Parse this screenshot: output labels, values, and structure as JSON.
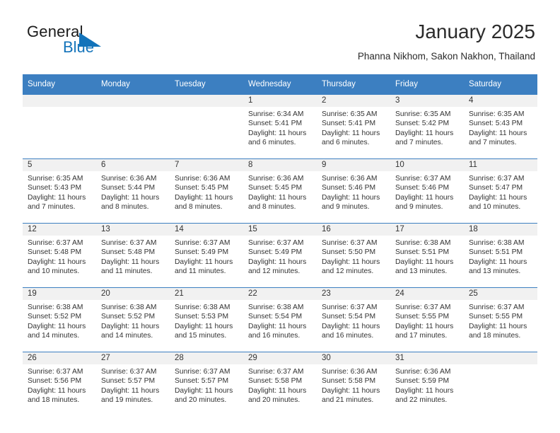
{
  "brand": {
    "word1": "General",
    "word2": "Blue",
    "logo_icon": "triangle-flag-icon",
    "accent_color": "#1373ba"
  },
  "header": {
    "month_title": "January 2025",
    "location": "Phanna Nikhom, Sakon Nakhon, Thailand",
    "header_bg_color": "#3c7fc1"
  },
  "calendar": {
    "weekday_headers": [
      "Sunday",
      "Monday",
      "Tuesday",
      "Wednesday",
      "Thursday",
      "Friday",
      "Saturday"
    ],
    "labels": {
      "sunrise": "Sunrise:",
      "sunset": "Sunset:",
      "daylight": "Daylight:"
    },
    "weeks": [
      [
        {
          "day": "",
          "empty": true
        },
        {
          "day": "",
          "empty": true
        },
        {
          "day": "",
          "empty": true
        },
        {
          "day": "1",
          "sunrise": "Sunrise: 6:34 AM",
          "sunset": "Sunset: 5:41 PM",
          "daylight_l1": "Daylight: 11 hours",
          "daylight_l2": "and 6 minutes."
        },
        {
          "day": "2",
          "sunrise": "Sunrise: 6:35 AM",
          "sunset": "Sunset: 5:41 PM",
          "daylight_l1": "Daylight: 11 hours",
          "daylight_l2": "and 6 minutes."
        },
        {
          "day": "3",
          "sunrise": "Sunrise: 6:35 AM",
          "sunset": "Sunset: 5:42 PM",
          "daylight_l1": "Daylight: 11 hours",
          "daylight_l2": "and 7 minutes."
        },
        {
          "day": "4",
          "sunrise": "Sunrise: 6:35 AM",
          "sunset": "Sunset: 5:43 PM",
          "daylight_l1": "Daylight: 11 hours",
          "daylight_l2": "and 7 minutes."
        }
      ],
      [
        {
          "day": "5",
          "sunrise": "Sunrise: 6:35 AM",
          "sunset": "Sunset: 5:43 PM",
          "daylight_l1": "Daylight: 11 hours",
          "daylight_l2": "and 7 minutes."
        },
        {
          "day": "6",
          "sunrise": "Sunrise: 6:36 AM",
          "sunset": "Sunset: 5:44 PM",
          "daylight_l1": "Daylight: 11 hours",
          "daylight_l2": "and 8 minutes."
        },
        {
          "day": "7",
          "sunrise": "Sunrise: 6:36 AM",
          "sunset": "Sunset: 5:45 PM",
          "daylight_l1": "Daylight: 11 hours",
          "daylight_l2": "and 8 minutes."
        },
        {
          "day": "8",
          "sunrise": "Sunrise: 6:36 AM",
          "sunset": "Sunset: 5:45 PM",
          "daylight_l1": "Daylight: 11 hours",
          "daylight_l2": "and 8 minutes."
        },
        {
          "day": "9",
          "sunrise": "Sunrise: 6:36 AM",
          "sunset": "Sunset: 5:46 PM",
          "daylight_l1": "Daylight: 11 hours",
          "daylight_l2": "and 9 minutes."
        },
        {
          "day": "10",
          "sunrise": "Sunrise: 6:37 AM",
          "sunset": "Sunset: 5:46 PM",
          "daylight_l1": "Daylight: 11 hours",
          "daylight_l2": "and 9 minutes."
        },
        {
          "day": "11",
          "sunrise": "Sunrise: 6:37 AM",
          "sunset": "Sunset: 5:47 PM",
          "daylight_l1": "Daylight: 11 hours",
          "daylight_l2": "and 10 minutes."
        }
      ],
      [
        {
          "day": "12",
          "sunrise": "Sunrise: 6:37 AM",
          "sunset": "Sunset: 5:48 PM",
          "daylight_l1": "Daylight: 11 hours",
          "daylight_l2": "and 10 minutes."
        },
        {
          "day": "13",
          "sunrise": "Sunrise: 6:37 AM",
          "sunset": "Sunset: 5:48 PM",
          "daylight_l1": "Daylight: 11 hours",
          "daylight_l2": "and 11 minutes."
        },
        {
          "day": "14",
          "sunrise": "Sunrise: 6:37 AM",
          "sunset": "Sunset: 5:49 PM",
          "daylight_l1": "Daylight: 11 hours",
          "daylight_l2": "and 11 minutes."
        },
        {
          "day": "15",
          "sunrise": "Sunrise: 6:37 AM",
          "sunset": "Sunset: 5:49 PM",
          "daylight_l1": "Daylight: 11 hours",
          "daylight_l2": "and 12 minutes."
        },
        {
          "day": "16",
          "sunrise": "Sunrise: 6:37 AM",
          "sunset": "Sunset: 5:50 PM",
          "daylight_l1": "Daylight: 11 hours",
          "daylight_l2": "and 12 minutes."
        },
        {
          "day": "17",
          "sunrise": "Sunrise: 6:38 AM",
          "sunset": "Sunset: 5:51 PM",
          "daylight_l1": "Daylight: 11 hours",
          "daylight_l2": "and 13 minutes."
        },
        {
          "day": "18",
          "sunrise": "Sunrise: 6:38 AM",
          "sunset": "Sunset: 5:51 PM",
          "daylight_l1": "Daylight: 11 hours",
          "daylight_l2": "and 13 minutes."
        }
      ],
      [
        {
          "day": "19",
          "sunrise": "Sunrise: 6:38 AM",
          "sunset": "Sunset: 5:52 PM",
          "daylight_l1": "Daylight: 11 hours",
          "daylight_l2": "and 14 minutes."
        },
        {
          "day": "20",
          "sunrise": "Sunrise: 6:38 AM",
          "sunset": "Sunset: 5:52 PM",
          "daylight_l1": "Daylight: 11 hours",
          "daylight_l2": "and 14 minutes."
        },
        {
          "day": "21",
          "sunrise": "Sunrise: 6:38 AM",
          "sunset": "Sunset: 5:53 PM",
          "daylight_l1": "Daylight: 11 hours",
          "daylight_l2": "and 15 minutes."
        },
        {
          "day": "22",
          "sunrise": "Sunrise: 6:38 AM",
          "sunset": "Sunset: 5:54 PM",
          "daylight_l1": "Daylight: 11 hours",
          "daylight_l2": "and 16 minutes."
        },
        {
          "day": "23",
          "sunrise": "Sunrise: 6:37 AM",
          "sunset": "Sunset: 5:54 PM",
          "daylight_l1": "Daylight: 11 hours",
          "daylight_l2": "and 16 minutes."
        },
        {
          "day": "24",
          "sunrise": "Sunrise: 6:37 AM",
          "sunset": "Sunset: 5:55 PM",
          "daylight_l1": "Daylight: 11 hours",
          "daylight_l2": "and 17 minutes."
        },
        {
          "day": "25",
          "sunrise": "Sunrise: 6:37 AM",
          "sunset": "Sunset: 5:55 PM",
          "daylight_l1": "Daylight: 11 hours",
          "daylight_l2": "and 18 minutes."
        }
      ],
      [
        {
          "day": "26",
          "sunrise": "Sunrise: 6:37 AM",
          "sunset": "Sunset: 5:56 PM",
          "daylight_l1": "Daylight: 11 hours",
          "daylight_l2": "and 18 minutes."
        },
        {
          "day": "27",
          "sunrise": "Sunrise: 6:37 AM",
          "sunset": "Sunset: 5:57 PM",
          "daylight_l1": "Daylight: 11 hours",
          "daylight_l2": "and 19 minutes."
        },
        {
          "day": "28",
          "sunrise": "Sunrise: 6:37 AM",
          "sunset": "Sunset: 5:57 PM",
          "daylight_l1": "Daylight: 11 hours",
          "daylight_l2": "and 20 minutes."
        },
        {
          "day": "29",
          "sunrise": "Sunrise: 6:37 AM",
          "sunset": "Sunset: 5:58 PM",
          "daylight_l1": "Daylight: 11 hours",
          "daylight_l2": "and 20 minutes."
        },
        {
          "day": "30",
          "sunrise": "Sunrise: 6:36 AM",
          "sunset": "Sunset: 5:58 PM",
          "daylight_l1": "Daylight: 11 hours",
          "daylight_l2": "and 21 minutes."
        },
        {
          "day": "31",
          "sunrise": "Sunrise: 6:36 AM",
          "sunset": "Sunset: 5:59 PM",
          "daylight_l1": "Daylight: 11 hours",
          "daylight_l2": "and 22 minutes."
        },
        {
          "day": "",
          "empty": true
        }
      ]
    ]
  }
}
